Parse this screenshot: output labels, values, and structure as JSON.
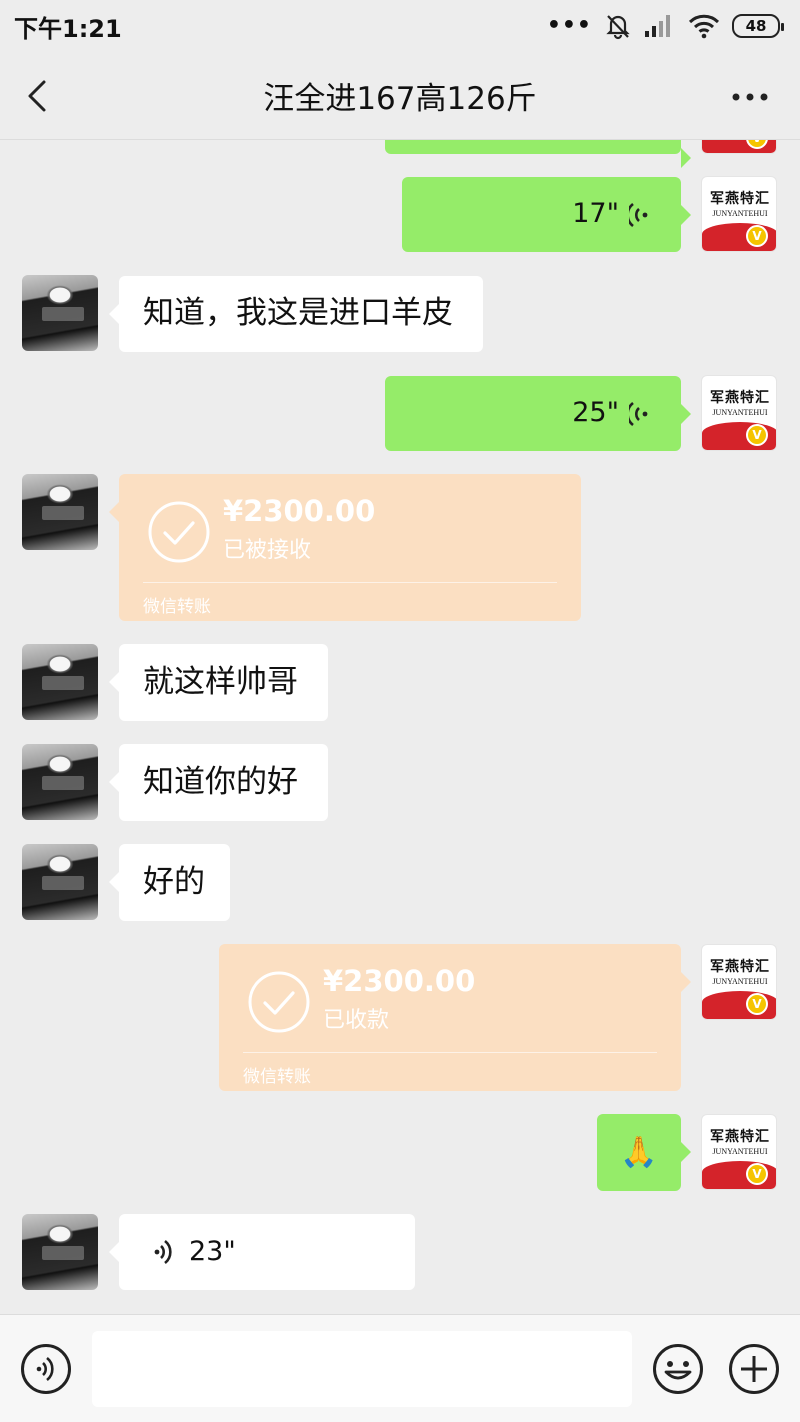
{
  "status_bar": {
    "time": "下午1:21",
    "battery": "48"
  },
  "header": {
    "title": "汪全进167高126斤"
  },
  "self_avatar": {
    "brand_cn": "军燕特汇",
    "brand_en": "JUNYANTEHUI",
    "badge": "V"
  },
  "messages": [
    {
      "id": "m1",
      "sender": "self",
      "type": "voice",
      "duration": "17\""
    },
    {
      "id": "m2",
      "sender": "other",
      "type": "text",
      "text": "知道，我这是进口羊皮"
    },
    {
      "id": "m3",
      "sender": "self",
      "type": "voice",
      "duration": "25\""
    },
    {
      "id": "m4",
      "sender": "other",
      "type": "transfer",
      "amount": "¥2300.00",
      "status": "已被接收",
      "footer": "微信转账"
    },
    {
      "id": "m5",
      "sender": "other",
      "type": "text",
      "text": "就这样帅哥"
    },
    {
      "id": "m6",
      "sender": "other",
      "type": "text",
      "text": "知道你的好"
    },
    {
      "id": "m7",
      "sender": "other",
      "type": "text",
      "text": "好的"
    },
    {
      "id": "m8",
      "sender": "self",
      "type": "transfer",
      "amount": "¥2300.00",
      "status": "已收款",
      "footer": "微信转账"
    },
    {
      "id": "m9",
      "sender": "self",
      "type": "emoji",
      "emoji": "🙏"
    },
    {
      "id": "m10",
      "sender": "other",
      "type": "voice",
      "duration": "23\""
    }
  ],
  "input_bar": {
    "value": "",
    "placeholder": ""
  },
  "colors": {
    "background": "#ededed",
    "self_bubble": "#95ec69",
    "other_bubble": "#ffffff",
    "transfer": "#fbdfc2",
    "brand_red": "#d4232a",
    "vip_gold": "#f5c400"
  },
  "icons": [
    "back-arrow-icon",
    "more-icon",
    "voice-wave-icon",
    "check-circle-icon",
    "voice-mode-icon",
    "emoji-icon",
    "plus-icon"
  ]
}
